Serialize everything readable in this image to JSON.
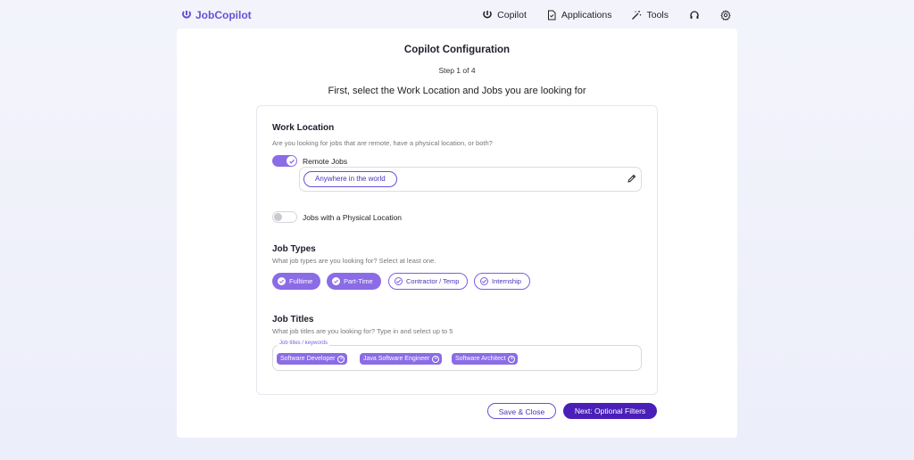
{
  "brand": {
    "name": "JobCopilot"
  },
  "nav": {
    "items": [
      {
        "label": "Copilot",
        "icon": "copilot-icon"
      },
      {
        "label": "Applications",
        "icon": "document-icon"
      },
      {
        "label": "Tools",
        "icon": "magic-wand-icon"
      }
    ],
    "support_icon": "headset-icon",
    "settings_icon": "gear-icon"
  },
  "page": {
    "title": "Copilot Configuration",
    "step": "Step 1 of 4",
    "subtitle": "First, select the Work Location and Jobs you are looking for"
  },
  "work_location": {
    "heading": "Work Location",
    "description": "Are you looking for jobs that are remote, have a physical location, or both?",
    "remote": {
      "label": "Remote Jobs",
      "enabled": true,
      "chip": "Anywhere in the world"
    },
    "physical": {
      "label": "Jobs with a Physical Location",
      "enabled": false
    }
  },
  "job_types": {
    "heading": "Job Types",
    "description": "What job types are you looking for? Select at least one.",
    "options": [
      {
        "label": "Fulltime",
        "selected": true
      },
      {
        "label": "Part-Time",
        "selected": true
      },
      {
        "label": "Contractor / Temp",
        "selected": false
      },
      {
        "label": "Internship",
        "selected": false
      }
    ]
  },
  "job_titles": {
    "heading": "Job Titles",
    "description": "What job titles are you looking for? Type in and select up to 5",
    "field_label": "Job titles / keywords",
    "tags": [
      "Software Developer",
      "Java Software Engineer",
      "Software Architect"
    ]
  },
  "actions": {
    "save_close": "Save & Close",
    "next": "Next: Optional Filters"
  },
  "colors": {
    "accent": "#8b6be6",
    "primary_button": "#4a1fb8",
    "brand": "#6a4fd8"
  }
}
